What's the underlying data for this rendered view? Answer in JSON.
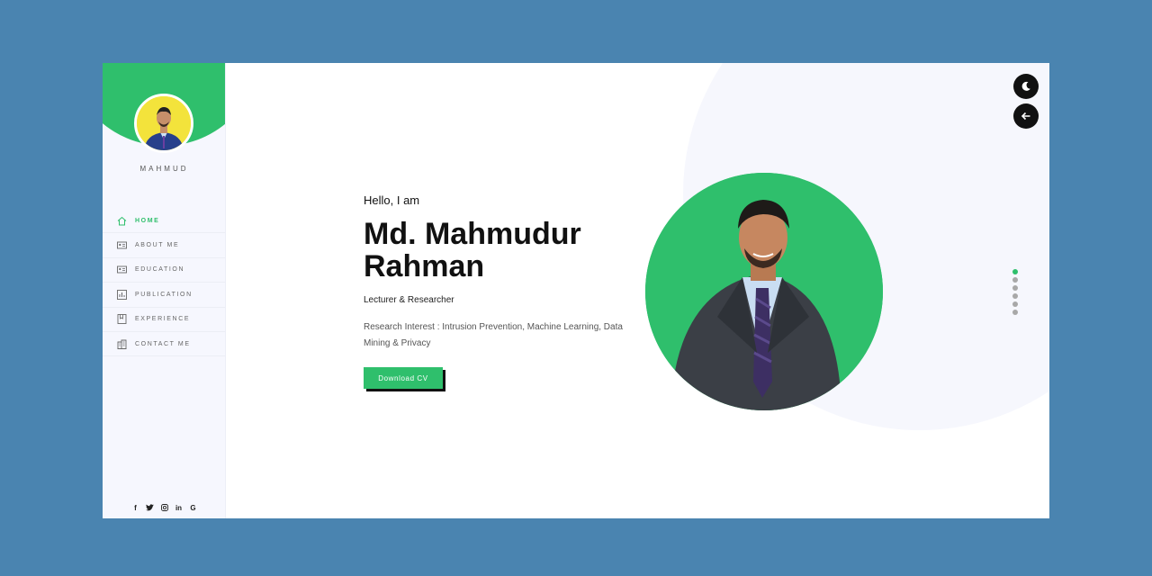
{
  "sidebar": {
    "brand": "MAHMUD",
    "nav": [
      {
        "label": "HOME",
        "icon": "home-icon",
        "active": true
      },
      {
        "label": "ABOUT ME",
        "icon": "id-card-icon",
        "active": false
      },
      {
        "label": "EDUCATION",
        "icon": "id-card-icon",
        "active": false
      },
      {
        "label": "PUBLICATION",
        "icon": "chart-icon",
        "active": false
      },
      {
        "label": "EXPERIENCE",
        "icon": "bookmark-icon",
        "active": false
      },
      {
        "label": "CONTACT ME",
        "icon": "building-icon",
        "active": false
      }
    ],
    "socials": [
      {
        "icon": "facebook-icon",
        "glyph": "f"
      },
      {
        "icon": "twitter-icon",
        "glyph": "🐦"
      },
      {
        "icon": "instagram-icon",
        "glyph": "◎"
      },
      {
        "icon": "linkedin-icon",
        "glyph": "in"
      },
      {
        "icon": "google-icon",
        "glyph": "G"
      }
    ]
  },
  "hero": {
    "greeting": "Hello, I am",
    "name": "Md. Mahmudur Rahman",
    "role": "Lecturer & Researcher",
    "interest": "Research Interest : Intrusion Prevention, Machine Learning, Data Mining & Privacy",
    "cv_button": "Download CV"
  },
  "controls": {
    "theme_toggle_icon": "moon-icon",
    "back_icon": "arrow-left-icon"
  },
  "pagination": {
    "count": 6,
    "active_index": 0
  },
  "colors": {
    "accent": "#2fbf6c",
    "page_bg": "#4a84b0",
    "sidebar_bg": "#f6f7fe",
    "dark": "#111111"
  }
}
